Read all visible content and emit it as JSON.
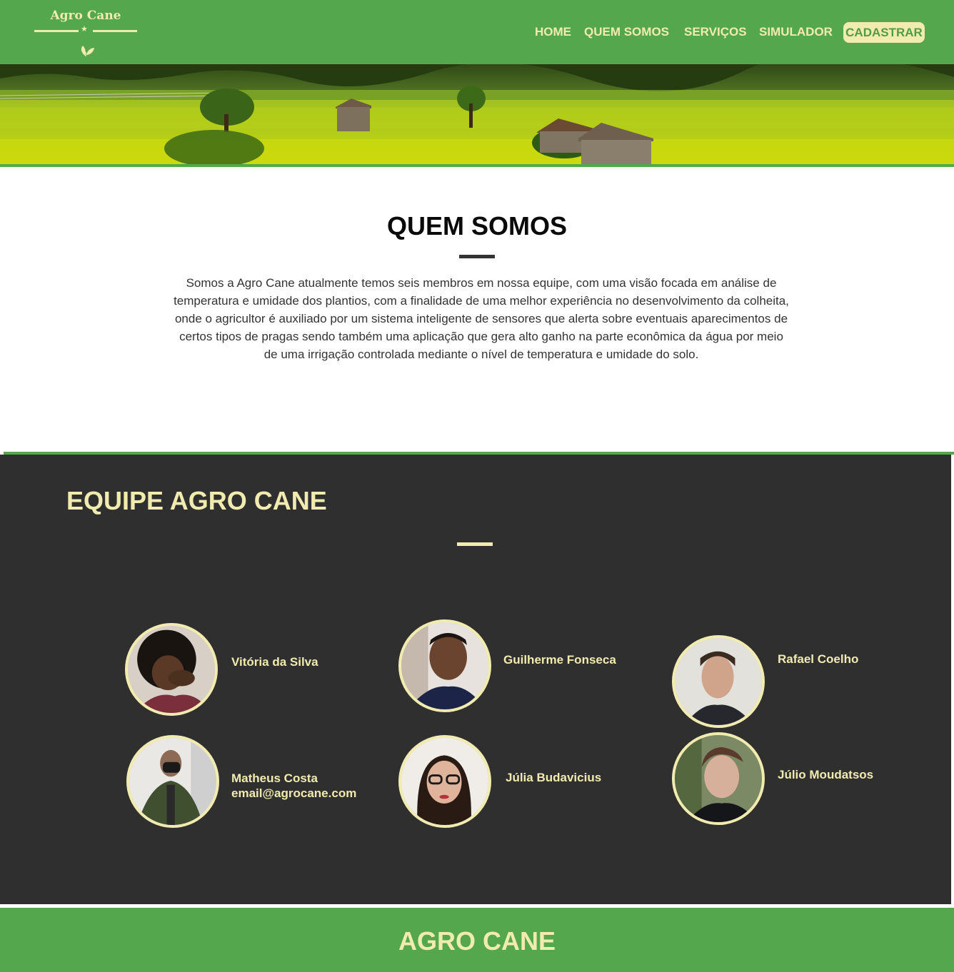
{
  "header": {
    "logo": {
      "title": "Agro Cane",
      "star": "★"
    },
    "nav": [
      {
        "label": "HOME"
      },
      {
        "label": "QUEM SOMOS"
      },
      {
        "label": "SERVIÇOS"
      },
      {
        "label": "SIMULADOR"
      }
    ],
    "cta_label": "CADASTRAR",
    "colors": {
      "green": "#55a74d",
      "cream": "#f1ebaf"
    }
  },
  "about": {
    "title": "QUEM SOMOS",
    "text": "Somos a Agro Cane atualmente temos seis membros em nossa equipe, com uma visão focada em análise de temperatura e umidade dos plantios, com a finalidade de uma melhor experiência no desenvolvimento da colheita, onde o agricultor é auxiliado por um sistema inteligente de sensores que alerta sobre eventuais aparecimentos de certos tipos de pragas sendo também uma aplicação que gera alto ganho na parte econômica da água por meio de uma irrigação controlada mediante o nível de temperatura e umidade do solo."
  },
  "team": {
    "title": "EQUIPE AGRO CANE",
    "members": [
      {
        "name": "Vitória da Silva"
      },
      {
        "name": "Guilherme Fonseca"
      },
      {
        "name": "Rafael Coelho"
      },
      {
        "name": "Matheus Costa",
        "email": "email@agrocane.com"
      },
      {
        "name": "Júlia Budavicius"
      },
      {
        "name": "Júlio Moudatsos"
      }
    ]
  },
  "footer": {
    "title": "AGRO CANE"
  }
}
